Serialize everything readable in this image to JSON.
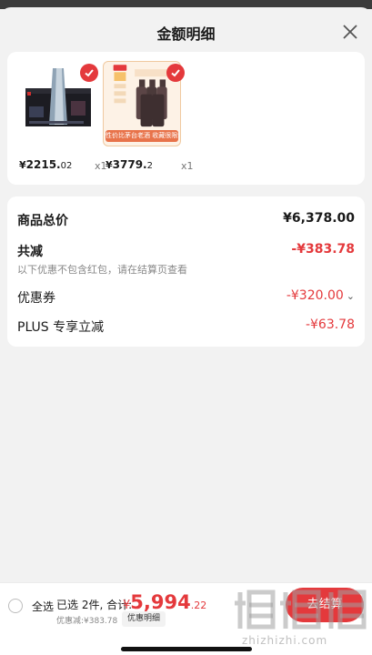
{
  "sheet": {
    "title": "金额明细"
  },
  "goods": [
    {
      "image": "lego-avengers-tower-box",
      "price_symbol": "¥",
      "price_int": "2215.",
      "price_dec": "02",
      "qty": "x1"
    },
    {
      "image": "baijiu-bottle-set",
      "price_symbol": "¥",
      "price_int": "3779.",
      "price_dec": "2",
      "qty": "x1",
      "promo_text": "性价比茅台老酒 收藏很限制"
    }
  ],
  "summary": {
    "total_label": "商品总价",
    "total_value": "¥6,378.00",
    "reduce_label": "共减",
    "reduce_value": "-¥383.78",
    "reduce_note": "以下优惠不包含红包，请在结算页查看",
    "coupon_label": "优惠券",
    "coupon_value": "-¥320.00",
    "plus_label": "PLUS 专享立减",
    "plus_value": "-¥63.78"
  },
  "bottom": {
    "select_all": "全选",
    "selected_info": "已选 2件, 合计:",
    "total_symbol": "¥",
    "total_int": "5,994",
    "total_dec": ".22",
    "discount_line": "优惠减:¥383.78",
    "detail_button": "优惠明细",
    "checkout_button": "去结算",
    "watermark": "zhizhizhi.com"
  },
  "colors": {
    "accent": "#e4393c",
    "background": "#f2f2f2"
  }
}
